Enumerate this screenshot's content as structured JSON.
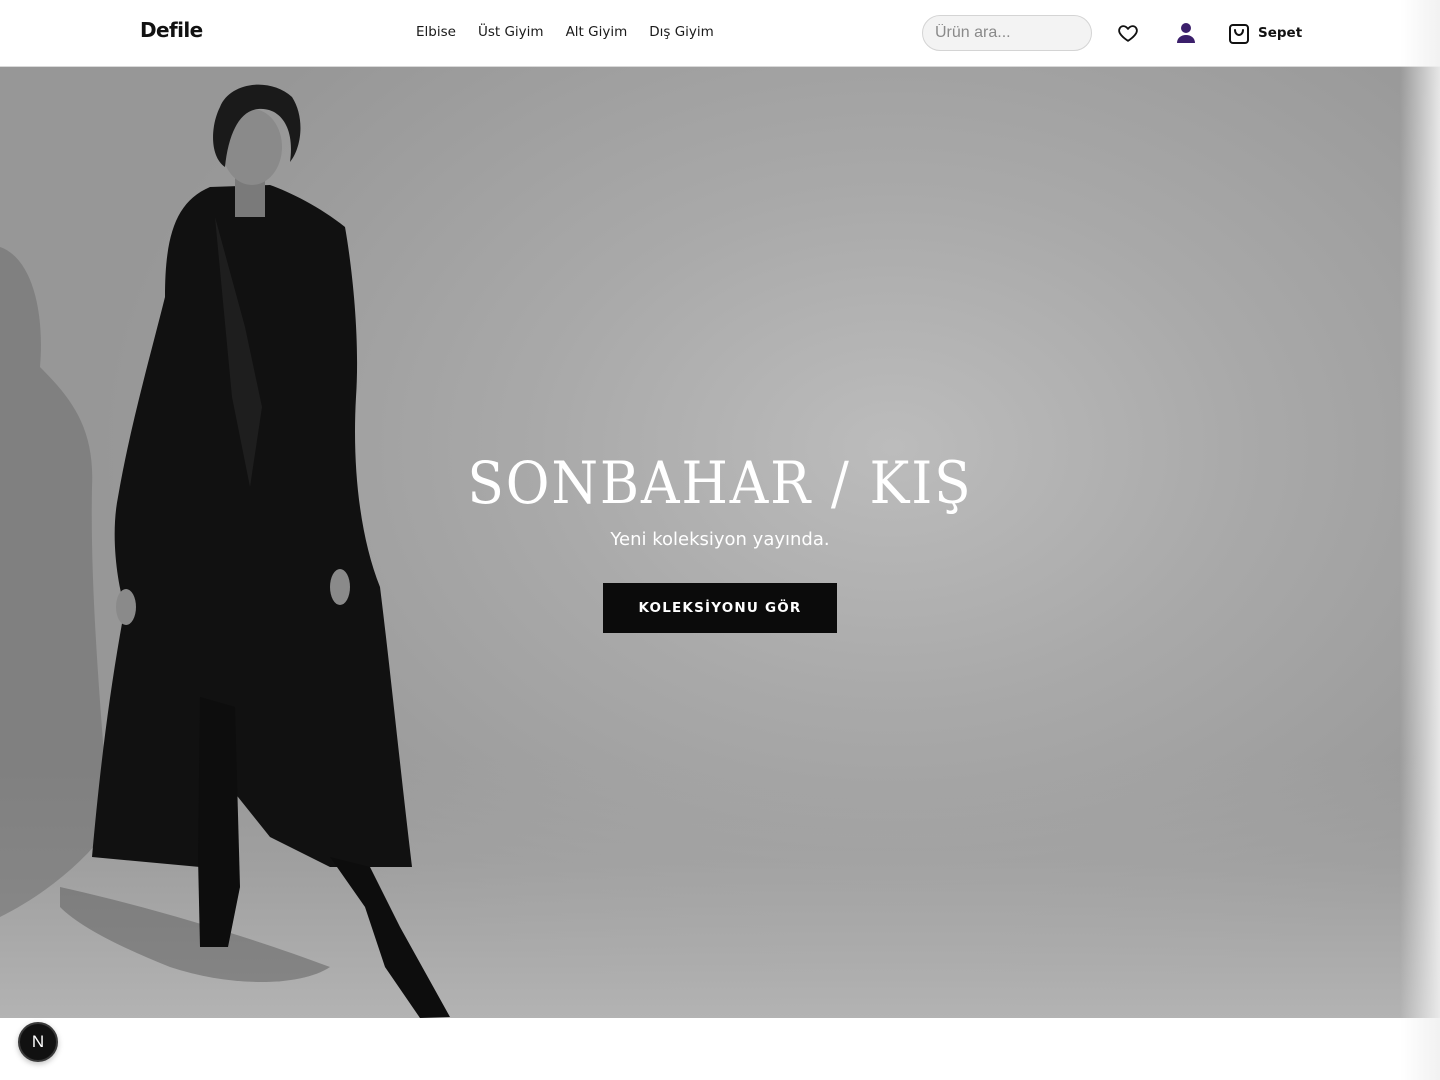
{
  "header": {
    "logo": "Defile",
    "nav": [
      {
        "label": "Elbise"
      },
      {
        "label": "Üst Giyim"
      },
      {
        "label": "Alt Giyim"
      },
      {
        "label": "Dış Giyim"
      }
    ],
    "search": {
      "placeholder": "Ürün ara...",
      "value": ""
    },
    "wishlist_icon": "heart-icon",
    "account_icon": "user-icon",
    "account_icon_color": "#3b1f6b",
    "cart": {
      "icon": "shopping-bag-icon",
      "label": "Sepet"
    }
  },
  "hero": {
    "title": "SONBAHAR / KIŞ",
    "subtitle": "Yeni koleksiyon yayında.",
    "cta_label": "KOLEKSİYONU GÖR",
    "cta_color": "#0b0b0b"
  },
  "badge": {
    "label": "N"
  }
}
